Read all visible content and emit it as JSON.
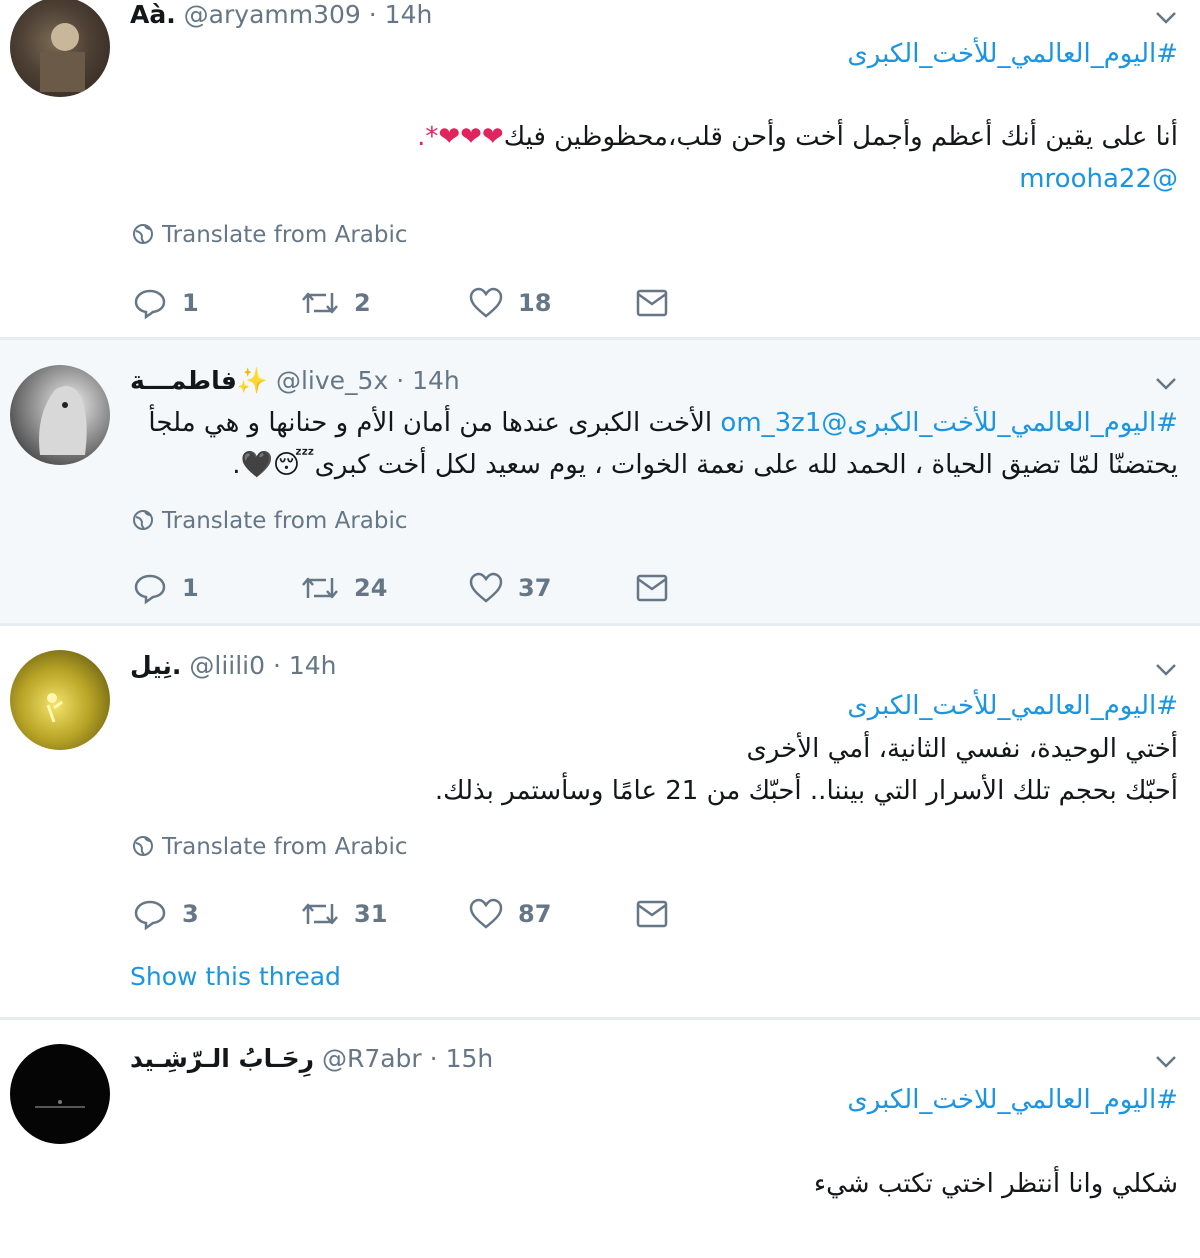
{
  "translate_label": "Translate from Arabic",
  "show_thread_label": "Show this thread",
  "tweets": [
    {
      "name": "Aà.",
      "handle": "@aryamm309",
      "dot": "·",
      "time": "14h",
      "hashtag": "#اليوم_العالمي_للأخت_الكبرى",
      "line1": "أنا على يقين أنك أعظم وأجمل أخت وأحن قلب،محظوظين فيك",
      "line1_tail": "❤❤❤*.",
      "mention": "@mrooha22",
      "replies": "1",
      "retweets": "2",
      "likes": "18"
    },
    {
      "name": "فاطمـــة✨",
      "handle": "@live_5x",
      "dot": "·",
      "time": "14h",
      "hashtag": "#اليوم_العالمي_للأخت_الكبرى",
      "mention": "@om_3z1",
      "line1": "الأخت الكبرى عندها من أمان الأم و حنانها و هي ملجأ",
      "line2": "يحتضنّا لمّا تضيق الحياة ، الحمد لله على نعمة الخوات ، يوم سعيد لكل أخت كبرى",
      "line2_tail": "😴🖤.",
      "replies": "1",
      "retweets": "24",
      "likes": "37"
    },
    {
      "name": "نِيل.",
      "handle": "@liili0",
      "dot": "·",
      "time": "14h",
      "hashtag": "#اليوم_العالمي_للأخت_الكبرى",
      "line1": "أختي الوحيدة، نفسي الثانية، أمي الأخرى",
      "line2": "أحبّك بحجم تلك الأسرار التي بيننا.. أحبّك من 21 عامًا وسأستمر بذلك.",
      "replies": "3",
      "retweets": "31",
      "likes": "87"
    },
    {
      "name": "رِحَـابُ الـرّشِـيد",
      "handle": "@R7abr",
      "dot": "·",
      "time": "15h",
      "hashtag": "#اليوم_العالمي_للاخت_الكبرى",
      "line1": "شكلي وانا أنتظر اختي تكتب شيء"
    }
  ],
  "colors": {
    "accent": "#1b95e0",
    "muted": "#657786",
    "heart": "#e0245e",
    "divider": "#e6ecf0",
    "highlight_bg": "#f5f8fa"
  },
  "icons": [
    "chevron-down-icon",
    "globe-icon",
    "reply-icon",
    "retweet-icon",
    "like-icon",
    "dm-icon"
  ]
}
